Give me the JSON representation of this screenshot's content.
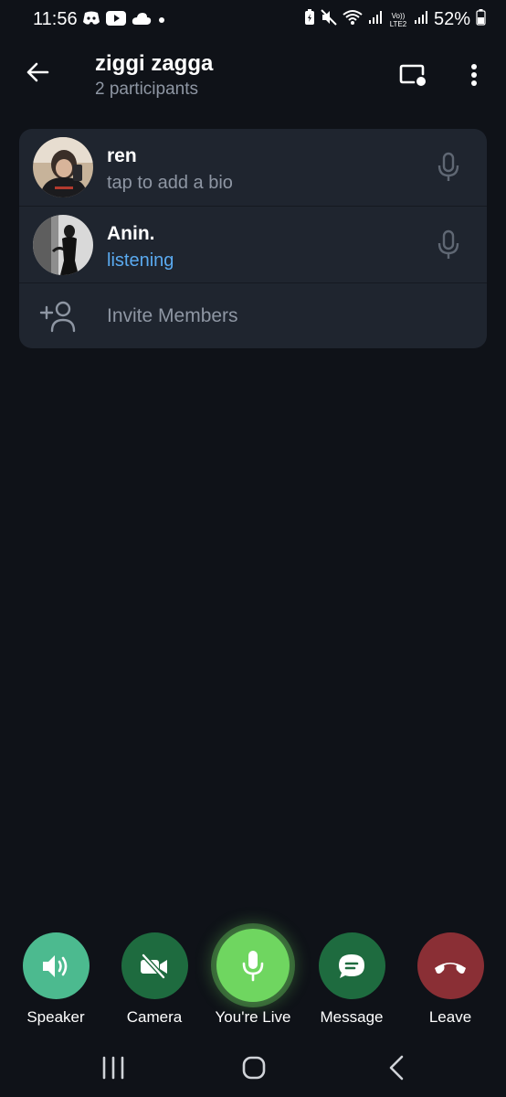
{
  "status_bar": {
    "time": "11:56",
    "battery": "52%",
    "left_icons": [
      "discord-icon",
      "youtube-icon",
      "cloud-icon",
      "dot-icon"
    ],
    "right_icons": [
      "battery-saver-icon",
      "mute-icon",
      "wifi-icon",
      "signal-icon",
      "volte-icon",
      "signal-icon",
      "battery-icon"
    ],
    "volte_text": "Vo)) LTE2"
  },
  "header": {
    "title": "ziggi zagga",
    "subtitle": "2 participants"
  },
  "participants": [
    {
      "name": "ren",
      "status": "tap to add a bio",
      "status_color": "#8e96a3"
    },
    {
      "name": "Anin.",
      "status": "listening",
      "status_color": "#5aaaf0"
    }
  ],
  "invite": {
    "label": "Invite Members"
  },
  "controls": {
    "speaker": {
      "label": "Speaker",
      "color": "#4cba8f"
    },
    "camera": {
      "label": "Camera",
      "color": "#1e6b3f"
    },
    "live": {
      "label": "You're Live",
      "color": "#6fd660"
    },
    "message": {
      "label": "Message",
      "color": "#1e6b3f"
    },
    "leave": {
      "label": "Leave",
      "color": "#8a2f35"
    }
  },
  "colors": {
    "background": "#0f1218",
    "card": "#1f252f",
    "muted_text": "#8e96a3",
    "accent_blue": "#5aaaf0"
  }
}
